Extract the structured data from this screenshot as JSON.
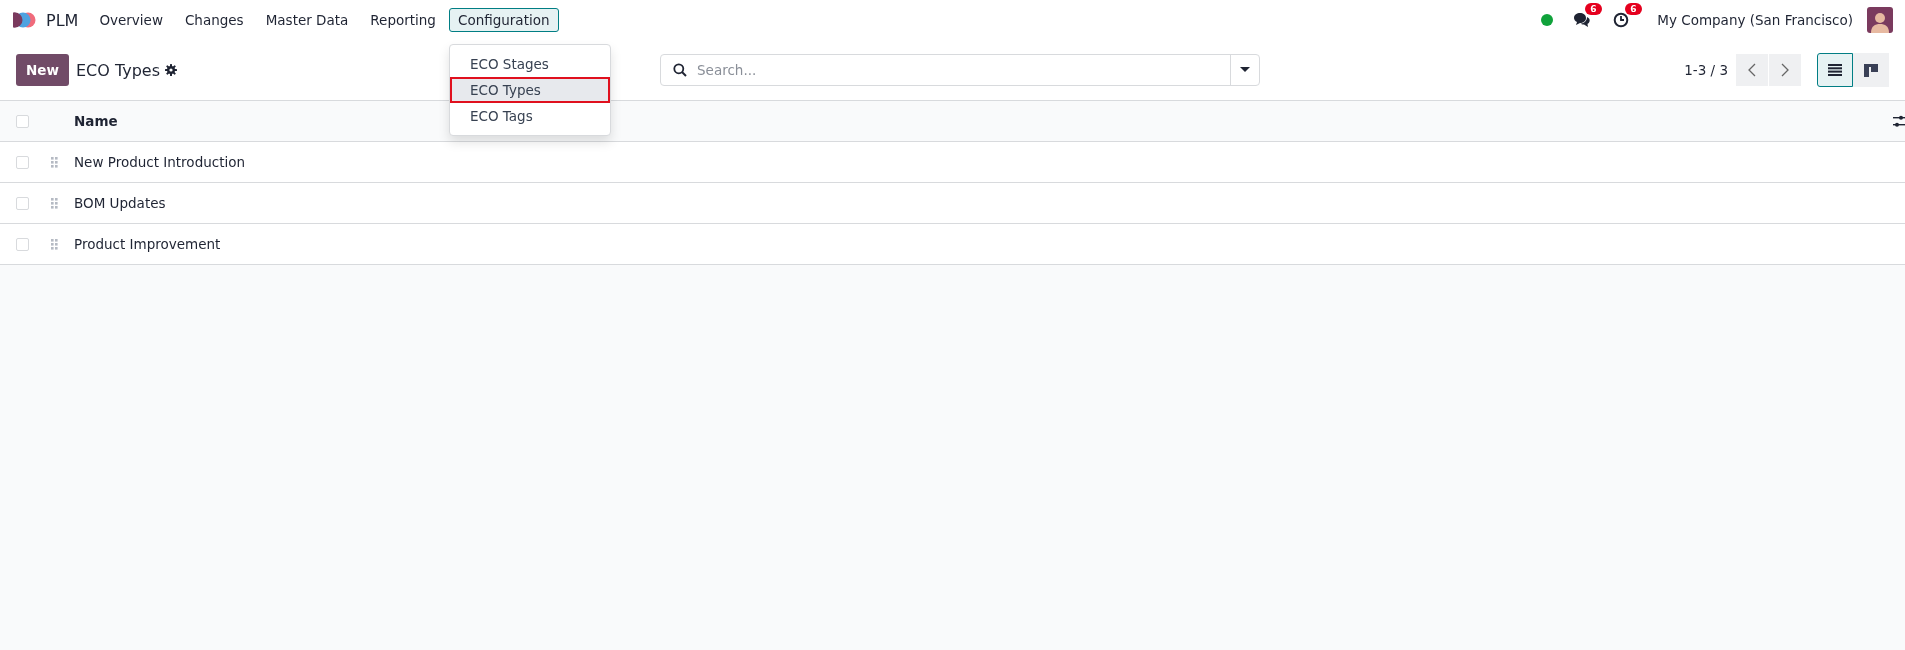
{
  "app_name": "PLM",
  "menu": [
    {
      "label": "Overview",
      "selected": false
    },
    {
      "label": "Changes",
      "selected": false
    },
    {
      "label": "Master Data",
      "selected": false
    },
    {
      "label": "Reporting",
      "selected": false
    },
    {
      "label": "Configuration",
      "selected": true
    }
  ],
  "dropdown": [
    {
      "label": "ECO Stages",
      "selected": false
    },
    {
      "label": "ECO Types",
      "selected": true
    },
    {
      "label": "ECO Tags",
      "selected": false
    }
  ],
  "systray": {
    "online": true,
    "messages_count": "6",
    "activities_count": "6",
    "company": "My Company (San Francisco)"
  },
  "control": {
    "new_button": "New",
    "title": "ECO Types",
    "search": {
      "placeholder": "Search..."
    },
    "pager": "1-3 / 3",
    "views": [
      {
        "kind": "list",
        "selected": true
      },
      {
        "kind": "kanban",
        "selected": false
      }
    ]
  },
  "table": {
    "select_all_checked": false,
    "columns": [
      "Name"
    ],
    "rows": [
      {
        "name": "New Product Introduction",
        "checked": false
      },
      {
        "name": "BOM Updates",
        "checked": false
      },
      {
        "name": "Product Improvement",
        "checked": false
      }
    ]
  }
}
